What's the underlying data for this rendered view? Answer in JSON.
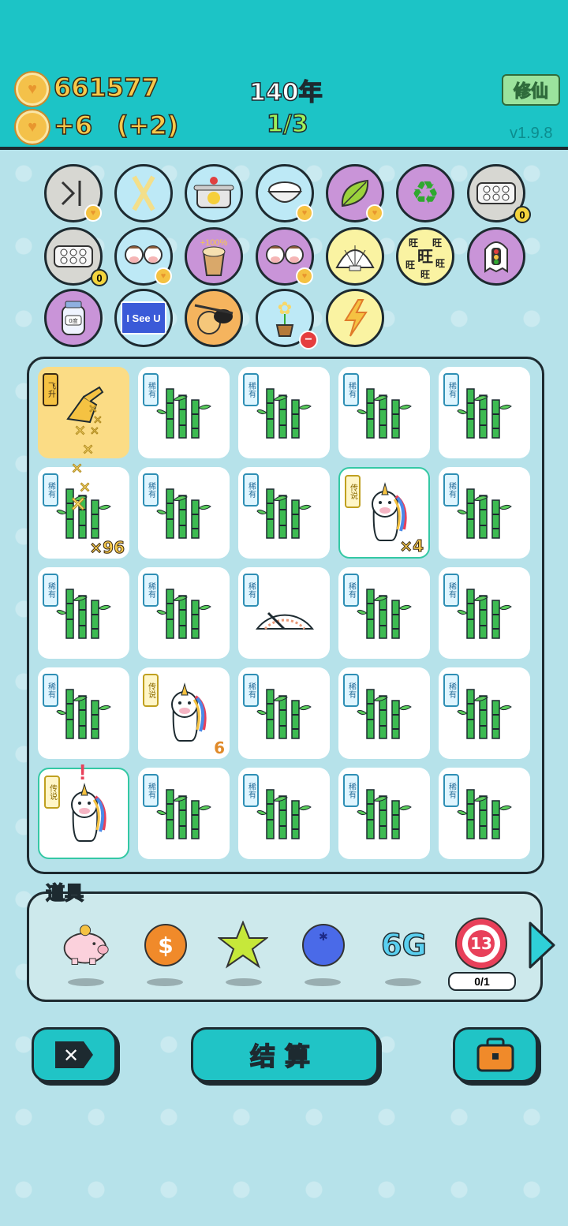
{
  "header": {
    "coins": "661577",
    "income": "+6",
    "bonus": "(+2)",
    "year": "140年",
    "progress": "1/3",
    "cultivate_label": "修仙",
    "version": "v1.9.8"
  },
  "items": {
    "row1": [
      {
        "icon": "skip-icon",
        "badge": "heart"
      },
      {
        "icon": "chopsticks-icon",
        "badge": ""
      },
      {
        "icon": "cooking-pot-icon",
        "badge": ""
      },
      {
        "icon": "rice-bowl-icon",
        "badge": "heart"
      },
      {
        "icon": "leaf-icon",
        "badge": "heart"
      },
      {
        "icon": "recycle-icon",
        "badge": ""
      },
      {
        "icon": "egg-tray-icon",
        "badge": "0"
      }
    ],
    "row2": [
      {
        "icon": "egg-tray-icon",
        "badge": "0"
      },
      {
        "icon": "cow-pair-icon",
        "badge": "heart"
      },
      {
        "icon": "milk-tea-icon",
        "badge": "",
        "label": "+100%"
      },
      {
        "icon": "cow-pair-icon",
        "badge": "heart"
      },
      {
        "icon": "shell-icon",
        "badge": ""
      },
      {
        "icon": "wang-text-icon",
        "badge": "",
        "label": "旺"
      },
      {
        "icon": "traffic-light-ghost-icon",
        "badge": ""
      }
    ],
    "row3": [
      {
        "icon": "jar-icon",
        "badge": "",
        "label": "0度"
      },
      {
        "icon": "i-see-u-icon",
        "badge": "",
        "label": "I See U"
      },
      {
        "icon": "eyepatch-egg-icon",
        "badge": ""
      },
      {
        "icon": "potted-flower-icon",
        "badge": "minus"
      },
      {
        "icon": "lightning-icon",
        "badge": ""
      }
    ]
  },
  "board": {
    "rare_tag": "稀有",
    "legend_tag": "传说",
    "fly_tag": "飞升",
    "cells": [
      {
        "type": "fly"
      },
      {
        "type": "bamboo"
      },
      {
        "type": "bamboo"
      },
      {
        "type": "bamboo"
      },
      {
        "type": "bamboo"
      },
      {
        "type": "bamboo-fly",
        "count": "×96"
      },
      {
        "type": "bamboo"
      },
      {
        "type": "bamboo"
      },
      {
        "type": "unicorn",
        "count": "×4"
      },
      {
        "type": "bamboo"
      },
      {
        "type": "bamboo"
      },
      {
        "type": "bamboo"
      },
      {
        "type": "gauge"
      },
      {
        "type": "bamboo"
      },
      {
        "type": "bamboo"
      },
      {
        "type": "bamboo"
      },
      {
        "type": "unicorn-plain",
        "count": "6"
      },
      {
        "type": "bamboo"
      },
      {
        "type": "bamboo"
      },
      {
        "type": "bamboo"
      },
      {
        "type": "unicorn-alert"
      },
      {
        "type": "bamboo"
      },
      {
        "type": "bamboo"
      },
      {
        "type": "bamboo"
      },
      {
        "type": "bamboo"
      }
    ]
  },
  "tools": {
    "title": "道具",
    "items": [
      "piggy-bank-icon",
      "dollar-coin-icon",
      "star-icon",
      "blue-ball-icon",
      "6g-icon",
      "target-icon"
    ],
    "g6_label": "6G",
    "target_number": "13",
    "target_counter": "0/1"
  },
  "buttons": {
    "settle_label": "结算"
  },
  "colors": {
    "header_bg": "#1cc4c6",
    "coin_text": "#f7c94a",
    "progress_text": "#9ef05a",
    "button_bg": "#20c4c6"
  }
}
